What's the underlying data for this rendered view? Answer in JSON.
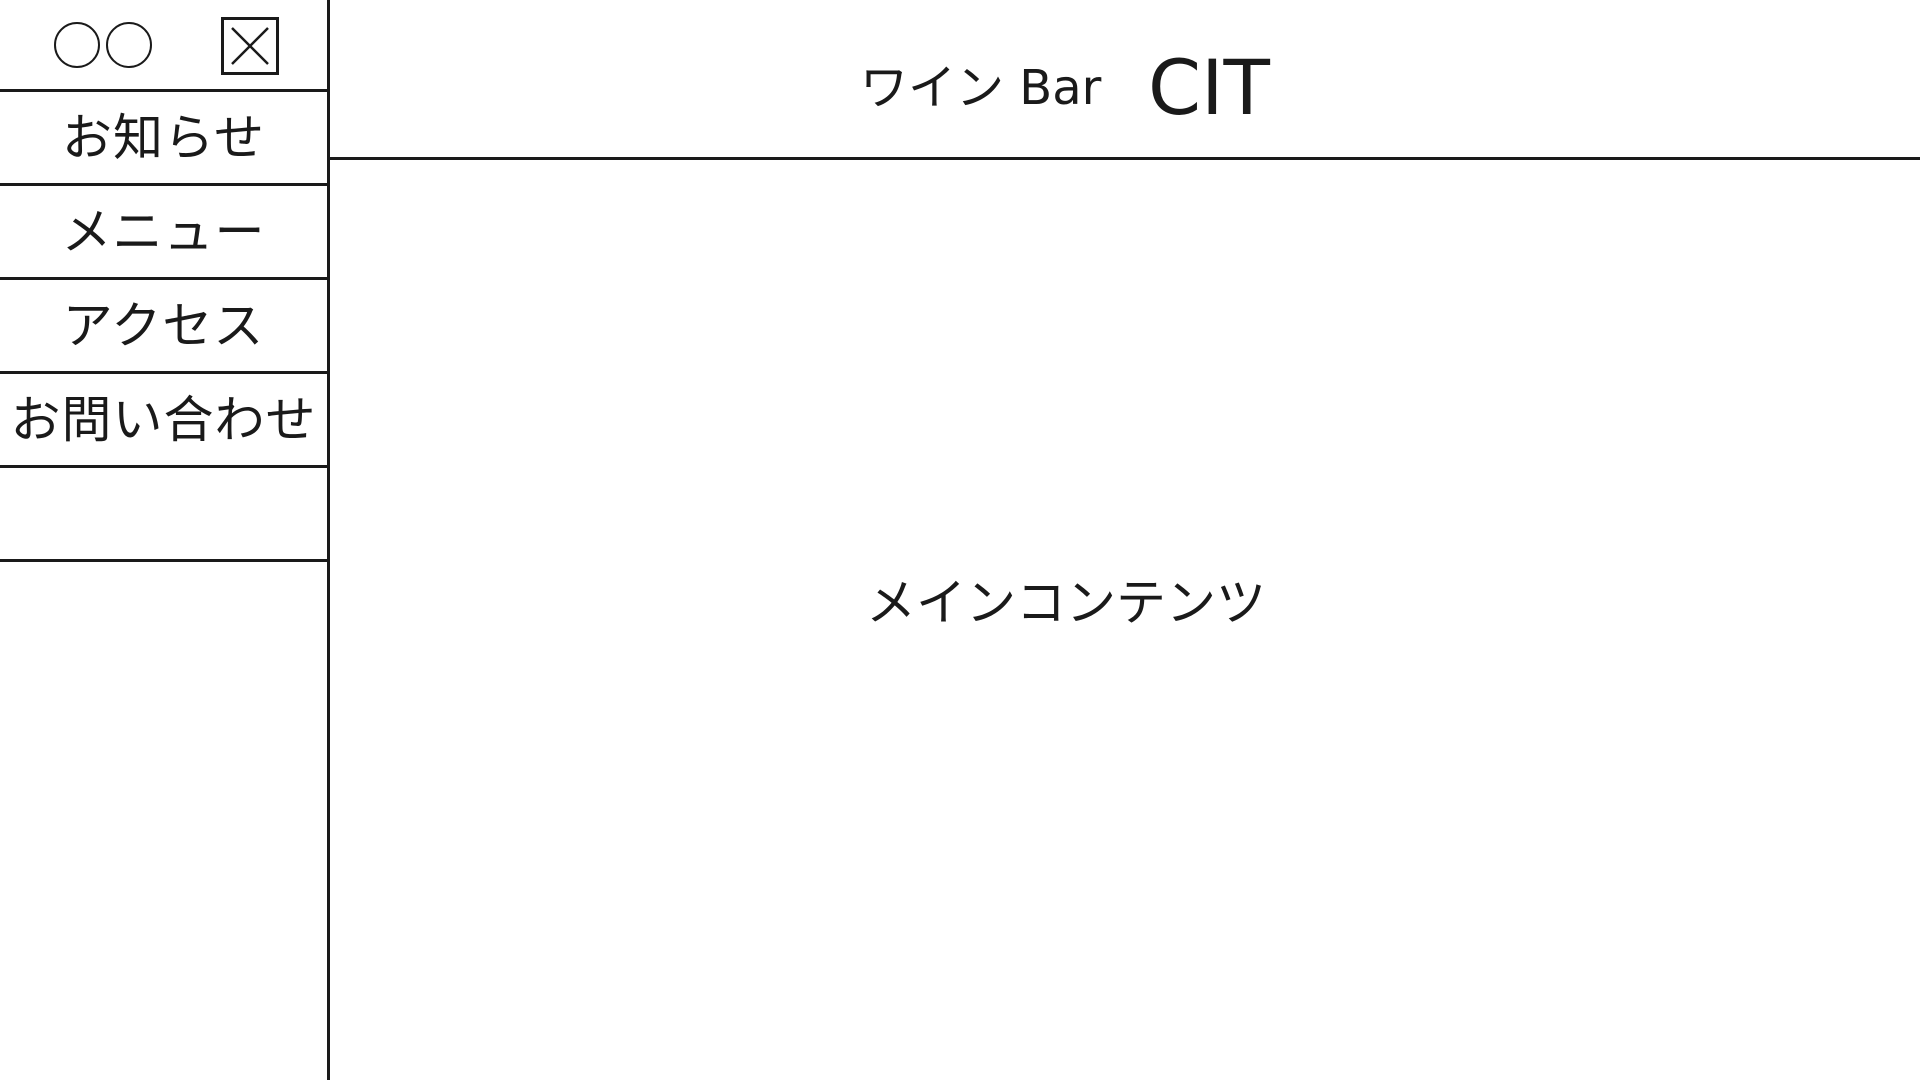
{
  "sidebar": {
    "top_icons": [
      "circle-outline",
      "circle-outline"
    ],
    "close_icon": "close-x-icon",
    "items": [
      {
        "label": "お知らせ"
      },
      {
        "label": "メニュー"
      },
      {
        "label": "アクセス"
      },
      {
        "label": "お問い合わせ"
      },
      {
        "label": ""
      }
    ]
  },
  "header": {
    "title": "ワイン Bar",
    "brand": "CIT"
  },
  "main": {
    "label": "メインコンテンツ"
  }
}
